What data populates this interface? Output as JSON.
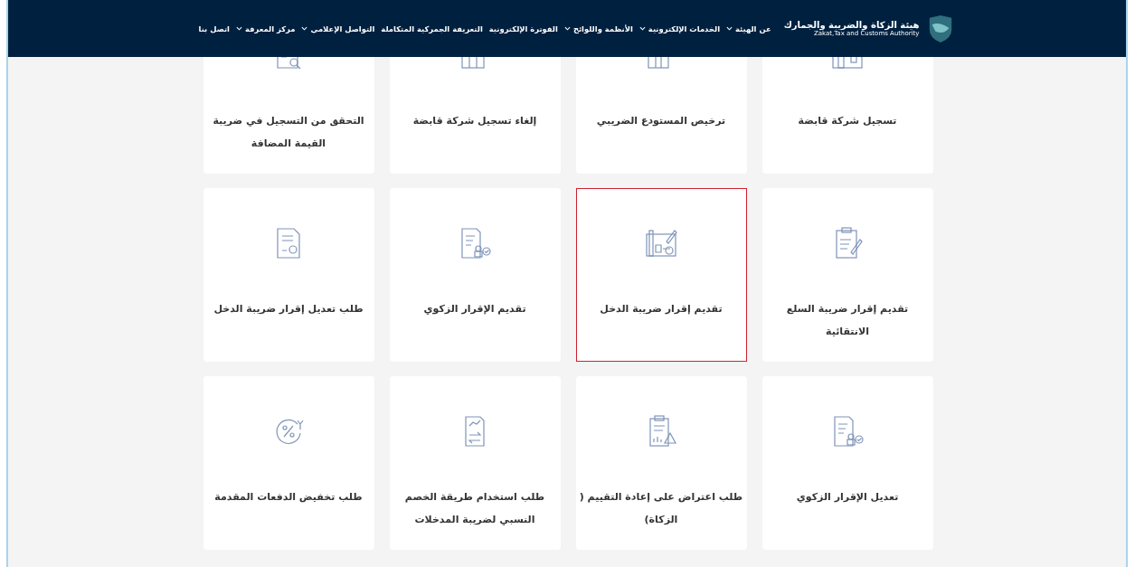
{
  "header": {
    "org_name_ar": "هيئة الزكاة والضريبة والجمارك",
    "org_name_en": "Zakat,Tax and Customs Authority",
    "nav": [
      {
        "label": "عن الهيئة",
        "dropdown": true
      },
      {
        "label": "الخدمات الإلكترونية",
        "dropdown": true
      },
      {
        "label": "الأنظمة واللوائح",
        "dropdown": true
      },
      {
        "label": "الفوترة الإلكترونية",
        "dropdown": false
      },
      {
        "label": "التعريفة الجمركية المتكاملة",
        "dropdown": false
      },
      {
        "label": "التواصل الإعلامي",
        "dropdown": true
      },
      {
        "label": "مركز المعرفة",
        "dropdown": true
      },
      {
        "label": "اتصل بنا",
        "dropdown": false
      }
    ]
  },
  "services": [
    {
      "label": "تسجيل شركة قابضة",
      "selected": false
    },
    {
      "label": "ترخيص المستودع الضريبي",
      "selected": false
    },
    {
      "label": "إلغاء تسجيل شركة قابضة",
      "selected": false
    },
    {
      "label": "التحقق من التسجيل في ضريبة القيمة المضافة",
      "selected": false
    },
    {
      "label": "تقديم إقرار ضريبة السلع الانتقائية",
      "selected": false
    },
    {
      "label": "تقديم إقرار ضريبة الدخل",
      "selected": true
    },
    {
      "label": "تقديم الإقرار الزكوي",
      "selected": false
    },
    {
      "label": "طلب تعديل إقرار ضريبة الدخل",
      "selected": false
    },
    {
      "label": "تعديل الإقرار الزكوي",
      "selected": false
    },
    {
      "label": "طلب اعتراض على إعادة التقييم ( الزكاة)",
      "selected": false
    },
    {
      "label": "طلب استخدام طريقة الخصم النسبي لضريبة المدخلات",
      "selected": false
    },
    {
      "label": "طلب تخفيض الدفعات المقدمة",
      "selected": false
    }
  ]
}
